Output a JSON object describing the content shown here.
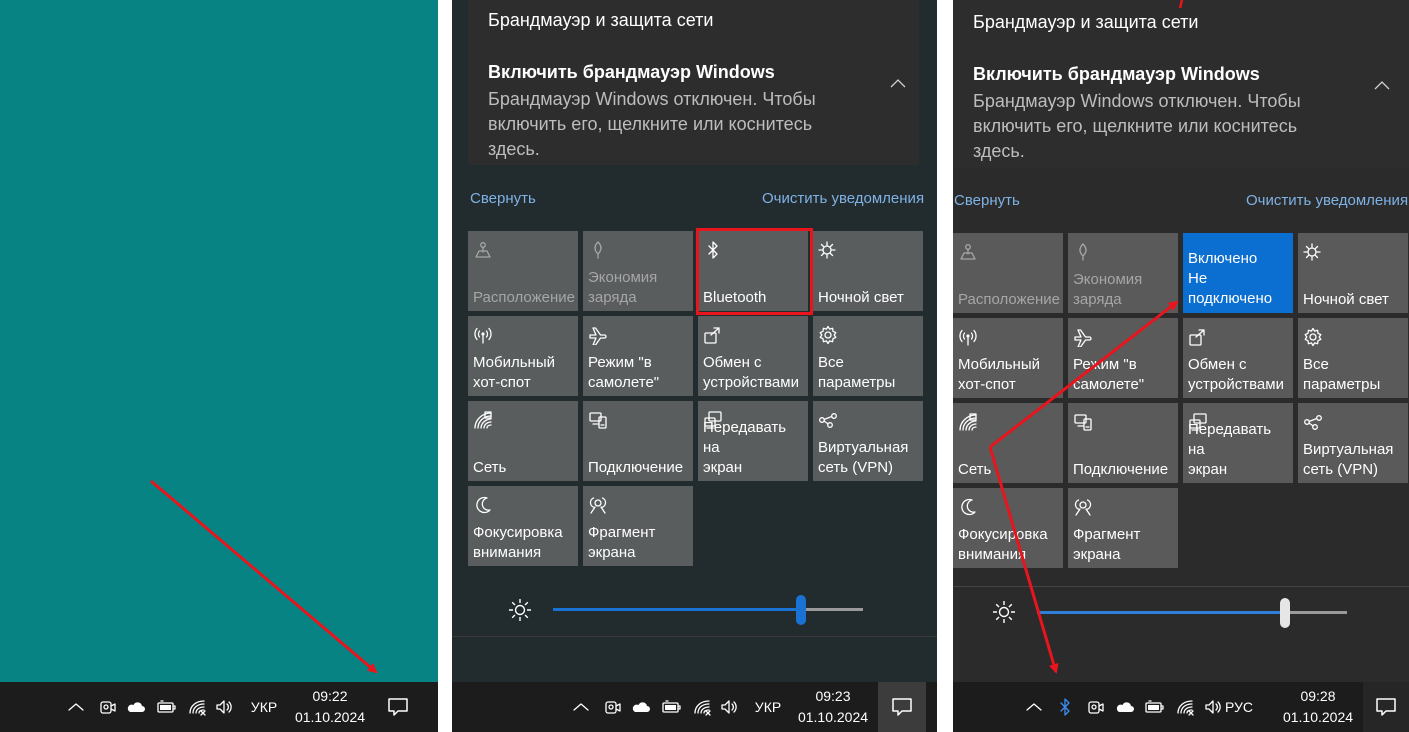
{
  "colors": {
    "desktop": "#088384",
    "accent": "#0b6fd2",
    "link": "#7fb2e5",
    "annotation": "#e8151d"
  },
  "panel1": {
    "taskbar": {
      "tray_icons": [
        "chevron-up-icon",
        "meet-now-icon",
        "onedrive-icon",
        "battery-icon",
        "wifi-icon",
        "volume-icon"
      ],
      "lang": "УКР",
      "time": "09:22",
      "date": "01.10.2024"
    }
  },
  "panel2": {
    "notification": {
      "source": "Брандмауэр и защита сети",
      "title": "Включить брандмауэр Windows",
      "body": "Брандмауэр Windows отключен. Чтобы включить его, щелкните или коснитесь здесь."
    },
    "collapse_label": "Свернуть",
    "clear_label": "Очистить уведомления",
    "tiles": [
      {
        "label": "Расположение",
        "icon": "location-icon",
        "state": "off"
      },
      {
        "label": "Экономия\nзаряда",
        "icon": "battery-saver-icon",
        "state": "off"
      },
      {
        "label": "Bluetooth",
        "icon": "bluetooth-icon",
        "state": "normal"
      },
      {
        "label": "Ночной свет",
        "icon": "night-light-icon",
        "state": "normal"
      },
      {
        "label": "Мобильный\nхот-спот",
        "icon": "hotspot-icon",
        "state": "normal"
      },
      {
        "label": "Режим \"в\nсамолете\"",
        "icon": "airplane-icon",
        "state": "normal"
      },
      {
        "label": "Обмен с\nустройствами",
        "icon": "nearby-share-icon",
        "state": "normal"
      },
      {
        "label": "Все параметры",
        "icon": "settings-icon",
        "state": "normal"
      },
      {
        "label": "Сеть",
        "icon": "network-icon",
        "state": "normal"
      },
      {
        "label": "Подключение",
        "icon": "connect-icon",
        "state": "normal"
      },
      {
        "label": "Передавать на\nэкран",
        "icon": "project-icon",
        "state": "normal"
      },
      {
        "label": "Виртуальная\nсеть (VPN)",
        "icon": "vpn-icon",
        "state": "normal"
      },
      {
        "label": "Фокусировка\nвнимания",
        "icon": "focus-assist-icon",
        "state": "normal"
      },
      {
        "label": "Фрагмент\nэкрана",
        "icon": "screen-snip-icon",
        "state": "normal"
      }
    ],
    "brightness": 0.8,
    "taskbar": {
      "tray_icons": [
        "chevron-up-icon",
        "meet-now-icon",
        "onedrive-icon",
        "battery-icon",
        "wifi-icon",
        "volume-icon"
      ],
      "lang": "УКР",
      "time": "09:23",
      "date": "01.10.2024"
    }
  },
  "panel3": {
    "notification": {
      "source": "Брандмауэр и защита сети",
      "title": "Включить брандмауэр Windows",
      "body": "Брандмауэр Windows отключен. Чтобы включить его, щелкните или коснитесь здесь."
    },
    "collapse_label": "Свернуть",
    "clear_label": "Очистить уведомления",
    "tiles": [
      {
        "label": "Расположение",
        "icon": "location-icon",
        "state": "off"
      },
      {
        "label": "Экономия\nзаряда",
        "icon": "battery-saver-icon",
        "state": "off"
      },
      {
        "label": "Включено\nНе\nподключено",
        "icon": "",
        "state": "on"
      },
      {
        "label": "Ночной свет",
        "icon": "night-light-icon",
        "state": "normal"
      },
      {
        "label": "Мобильный\nхот-спот",
        "icon": "hotspot-icon",
        "state": "normal"
      },
      {
        "label": "Режим \"в\nсамолете\"",
        "icon": "airplane-icon",
        "state": "normal"
      },
      {
        "label": "Обмен с\nустройствами",
        "icon": "nearby-share-icon",
        "state": "normal"
      },
      {
        "label": "Все параметры",
        "icon": "settings-icon",
        "state": "normal"
      },
      {
        "label": "Сеть",
        "icon": "network-icon",
        "state": "normal"
      },
      {
        "label": "Подключение",
        "icon": "connect-icon",
        "state": "normal"
      },
      {
        "label": "Передавать на\nэкран",
        "icon": "project-icon",
        "state": "normal"
      },
      {
        "label": "Виртуальная\nсеть (VPN)",
        "icon": "vpn-icon",
        "state": "normal"
      },
      {
        "label": "Фокусировка\nвнимания",
        "icon": "focus-assist-icon",
        "state": "normal"
      },
      {
        "label": "Фрагмент\nэкрана",
        "icon": "screen-snip-icon",
        "state": "normal"
      }
    ],
    "brightness": 0.8,
    "taskbar": {
      "tray_icons": [
        "chevron-up-icon",
        "bluetooth-icon",
        "meet-now-icon",
        "onedrive-icon",
        "battery-icon",
        "wifi-icon",
        "volume-icon"
      ],
      "lang": "РУС",
      "time": "09:28",
      "date": "01.10.2024"
    }
  }
}
